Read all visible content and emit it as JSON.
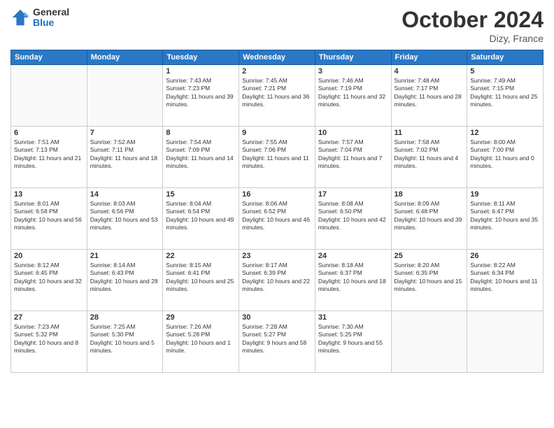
{
  "header": {
    "logo_general": "General",
    "logo_blue": "Blue",
    "month": "October 2024",
    "location": "Dizy, France"
  },
  "days_of_week": [
    "Sunday",
    "Monday",
    "Tuesday",
    "Wednesday",
    "Thursday",
    "Friday",
    "Saturday"
  ],
  "weeks": [
    [
      {
        "day": "",
        "info": ""
      },
      {
        "day": "",
        "info": ""
      },
      {
        "day": "1",
        "info": "Sunrise: 7:43 AM\nSunset: 7:23 PM\nDaylight: 11 hours and 39 minutes."
      },
      {
        "day": "2",
        "info": "Sunrise: 7:45 AM\nSunset: 7:21 PM\nDaylight: 11 hours and 36 minutes."
      },
      {
        "day": "3",
        "info": "Sunrise: 7:46 AM\nSunset: 7:19 PM\nDaylight: 11 hours and 32 minutes."
      },
      {
        "day": "4",
        "info": "Sunrise: 7:48 AM\nSunset: 7:17 PM\nDaylight: 11 hours and 28 minutes."
      },
      {
        "day": "5",
        "info": "Sunrise: 7:49 AM\nSunset: 7:15 PM\nDaylight: 11 hours and 25 minutes."
      }
    ],
    [
      {
        "day": "6",
        "info": "Sunrise: 7:51 AM\nSunset: 7:13 PM\nDaylight: 11 hours and 21 minutes."
      },
      {
        "day": "7",
        "info": "Sunrise: 7:52 AM\nSunset: 7:11 PM\nDaylight: 11 hours and 18 minutes."
      },
      {
        "day": "8",
        "info": "Sunrise: 7:54 AM\nSunset: 7:09 PM\nDaylight: 11 hours and 14 minutes."
      },
      {
        "day": "9",
        "info": "Sunrise: 7:55 AM\nSunset: 7:06 PM\nDaylight: 11 hours and 11 minutes."
      },
      {
        "day": "10",
        "info": "Sunrise: 7:57 AM\nSunset: 7:04 PM\nDaylight: 11 hours and 7 minutes."
      },
      {
        "day": "11",
        "info": "Sunrise: 7:58 AM\nSunset: 7:02 PM\nDaylight: 11 hours and 4 minutes."
      },
      {
        "day": "12",
        "info": "Sunrise: 8:00 AM\nSunset: 7:00 PM\nDaylight: 11 hours and 0 minutes."
      }
    ],
    [
      {
        "day": "13",
        "info": "Sunrise: 8:01 AM\nSunset: 6:58 PM\nDaylight: 10 hours and 56 minutes."
      },
      {
        "day": "14",
        "info": "Sunrise: 8:03 AM\nSunset: 6:56 PM\nDaylight: 10 hours and 53 minutes."
      },
      {
        "day": "15",
        "info": "Sunrise: 8:04 AM\nSunset: 6:54 PM\nDaylight: 10 hours and 49 minutes."
      },
      {
        "day": "16",
        "info": "Sunrise: 8:06 AM\nSunset: 6:52 PM\nDaylight: 10 hours and 46 minutes."
      },
      {
        "day": "17",
        "info": "Sunrise: 8:08 AM\nSunset: 6:50 PM\nDaylight: 10 hours and 42 minutes."
      },
      {
        "day": "18",
        "info": "Sunrise: 8:09 AM\nSunset: 6:48 PM\nDaylight: 10 hours and 39 minutes."
      },
      {
        "day": "19",
        "info": "Sunrise: 8:11 AM\nSunset: 6:47 PM\nDaylight: 10 hours and 35 minutes."
      }
    ],
    [
      {
        "day": "20",
        "info": "Sunrise: 8:12 AM\nSunset: 6:45 PM\nDaylight: 10 hours and 32 minutes."
      },
      {
        "day": "21",
        "info": "Sunrise: 8:14 AM\nSunset: 6:43 PM\nDaylight: 10 hours and 28 minutes."
      },
      {
        "day": "22",
        "info": "Sunrise: 8:15 AM\nSunset: 6:41 PM\nDaylight: 10 hours and 25 minutes."
      },
      {
        "day": "23",
        "info": "Sunrise: 8:17 AM\nSunset: 6:39 PM\nDaylight: 10 hours and 22 minutes."
      },
      {
        "day": "24",
        "info": "Sunrise: 8:18 AM\nSunset: 6:37 PM\nDaylight: 10 hours and 18 minutes."
      },
      {
        "day": "25",
        "info": "Sunrise: 8:20 AM\nSunset: 6:35 PM\nDaylight: 10 hours and 15 minutes."
      },
      {
        "day": "26",
        "info": "Sunrise: 8:22 AM\nSunset: 6:34 PM\nDaylight: 10 hours and 11 minutes."
      }
    ],
    [
      {
        "day": "27",
        "info": "Sunrise: 7:23 AM\nSunset: 5:32 PM\nDaylight: 10 hours and 8 minutes."
      },
      {
        "day": "28",
        "info": "Sunrise: 7:25 AM\nSunset: 5:30 PM\nDaylight: 10 hours and 5 minutes."
      },
      {
        "day": "29",
        "info": "Sunrise: 7:26 AM\nSunset: 5:28 PM\nDaylight: 10 hours and 1 minute."
      },
      {
        "day": "30",
        "info": "Sunrise: 7:28 AM\nSunset: 5:27 PM\nDaylight: 9 hours and 58 minutes."
      },
      {
        "day": "31",
        "info": "Sunrise: 7:30 AM\nSunset: 5:25 PM\nDaylight: 9 hours and 55 minutes."
      },
      {
        "day": "",
        "info": ""
      },
      {
        "day": "",
        "info": ""
      }
    ]
  ]
}
